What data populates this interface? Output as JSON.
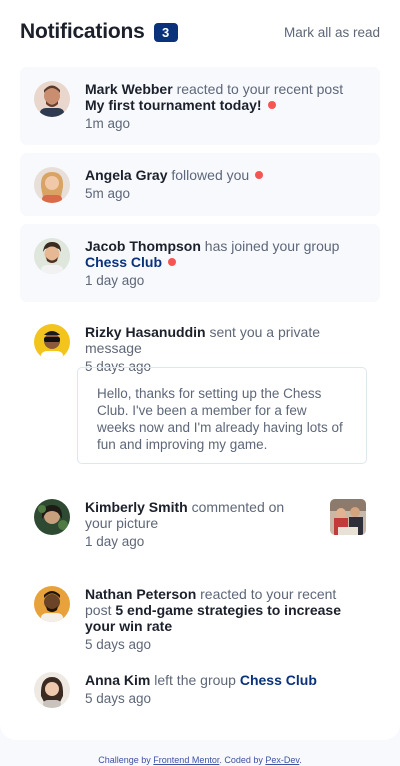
{
  "header": {
    "title": "Notifications",
    "unread_count": "3",
    "mark_all": "Mark all as read"
  },
  "notifications": [
    {
      "name": "Mark Webber",
      "action": "reacted to your recent post",
      "target": "My first tournament today!",
      "time": "1m ago",
      "unread": true
    },
    {
      "name": "Angela Gray",
      "action": "followed you",
      "target": "",
      "time": "5m ago",
      "unread": true
    },
    {
      "name": "Jacob Thompson",
      "action": "has joined your group",
      "target": "Chess Club",
      "time": "1 day ago",
      "unread": true
    },
    {
      "name": "Rizky Hasanuddin",
      "action": "sent you a private message",
      "target": "",
      "time": "5 days ago",
      "unread": false,
      "message": "Hello, thanks for setting up the Chess Club. I've been a member for a few weeks now and I'm already having lots of fun and improving my game."
    },
    {
      "name": "Kimberly Smith",
      "action": "commented on your picture",
      "target": "",
      "time": "1 day ago",
      "unread": false
    },
    {
      "name": "Nathan Peterson",
      "action": "reacted to your recent post",
      "target": "5 end-game strategies to increase your win rate",
      "time": "5 days ago",
      "unread": false
    },
    {
      "name": "Anna Kim",
      "action": "left the group",
      "target": "Chess Club",
      "time": "5 days ago",
      "unread": false
    }
  ],
  "footer": {
    "prefix": "Challenge by",
    "link1": "Frontend Mentor",
    "middle": ". Coded by",
    "link2": "Pex-Dev",
    "suffix": "."
  },
  "colors": {
    "accent": "#0a327b",
    "unread_dot": "#f65552",
    "unread_bg": "#f7f9fd"
  }
}
